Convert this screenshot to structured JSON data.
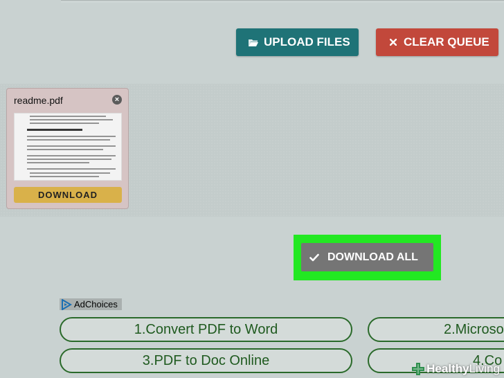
{
  "toolbar": {
    "upload_label": "UPLOAD FILES",
    "clear_label": "CLEAR QUEUE",
    "upload_icon": "folder-open-icon",
    "clear_icon": "close-icon",
    "upload_color": "#1f7377",
    "clear_color": "#c2483b"
  },
  "queue": {
    "files": [
      {
        "name": "readme.pdf",
        "download_label": "DOWNLOAD"
      }
    ]
  },
  "download_all": {
    "label": "DOWNLOAD ALL",
    "icon": "checkmark-icon",
    "highlight_color": "#22e822"
  },
  "ads": {
    "adchoices_label": "AdChoices",
    "links": [
      "1.Convert PDF to Word",
      "2.Microso",
      "3.PDF to Doc Online",
      "4.Co"
    ]
  },
  "watermark": {
    "brand_bold": "Healthy",
    "brand_light": " Living"
  }
}
